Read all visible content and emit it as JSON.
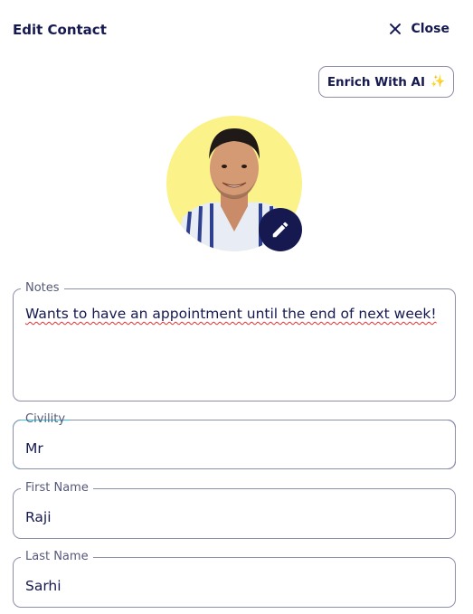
{
  "header": {
    "title": "Edit Contact",
    "close_label": "Close"
  },
  "enrich": {
    "label": "Enrich With AI",
    "icon": "sparkles-icon"
  },
  "avatar": {
    "background_color": "#fbf28a",
    "edit_icon": "pencil-icon"
  },
  "form": {
    "notes": {
      "label": "Notes",
      "value": "Wants to have an appointment until the end of next week!"
    },
    "civility": {
      "label": "Civility",
      "value": "Mr"
    },
    "first_name": {
      "label": "First Name",
      "value": "Raji"
    },
    "last_name": {
      "label": "Last Name",
      "value": "Sarhi"
    }
  },
  "colors": {
    "primary": "#16194f",
    "focus_gradient_start": "#2ad4e0",
    "focus_gradient_end": "#2a2ab8"
  }
}
